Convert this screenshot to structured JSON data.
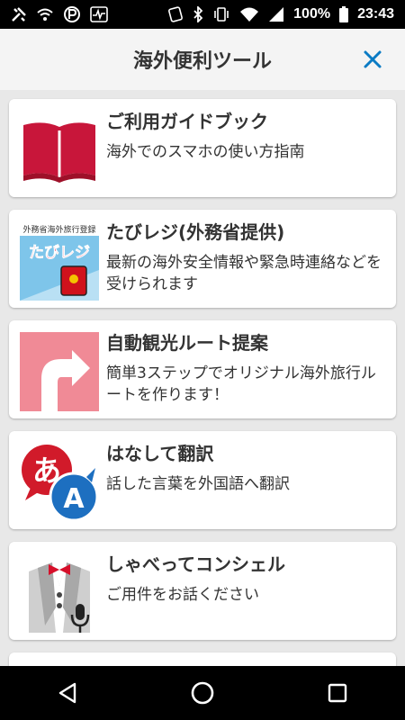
{
  "status_bar": {
    "battery_percent": "100%",
    "time": "23:43",
    "left_icons": [
      "tools-icon",
      "wifi-off-icon",
      "parking-icon",
      "activity-icon"
    ],
    "right_icons": [
      "nfc-icon",
      "bluetooth-icon",
      "vibrate-icon",
      "wifi-icon",
      "signal-icon",
      "battery-icon"
    ]
  },
  "header": {
    "title": "海外便利ツール",
    "close_icon": "close-icon"
  },
  "items": [
    {
      "title": "ご利用ガイドブック",
      "description": "海外でのスマホの使い方指南",
      "icon": "book-icon"
    },
    {
      "title": "たびレジ(外務省提供)",
      "description": "最新の海外安全情報や緊急時連絡などを受けられます",
      "icon": "tabireji-icon",
      "icon_text_top": "外務省海外旅行登録",
      "icon_text_logo": "たびレジ"
    },
    {
      "title": "自動観光ルート提案",
      "description": "簡単3ステップでオリジナル海外旅行ルートを作ります！",
      "icon": "route-arrow-icon"
    },
    {
      "title": "はなして翻訳",
      "description": "話した言葉を外国語へ翻訳",
      "icon": "translate-icon",
      "icon_glyph_1": "あ",
      "icon_glyph_2": "A"
    },
    {
      "title": "しゃべってコンシェル",
      "description": "ご用件をお話ください",
      "icon": "concierge-icon"
    }
  ],
  "colors": {
    "book_red": "#c8163a",
    "route_pink": "#f08a96",
    "translate_red": "#d11a2a",
    "translate_blue": "#1d6fc0",
    "close_blue": "#0a7bc4"
  },
  "navbar": {
    "back_icon": "back-icon",
    "home_icon": "home-icon",
    "recents_icon": "recents-icon"
  }
}
